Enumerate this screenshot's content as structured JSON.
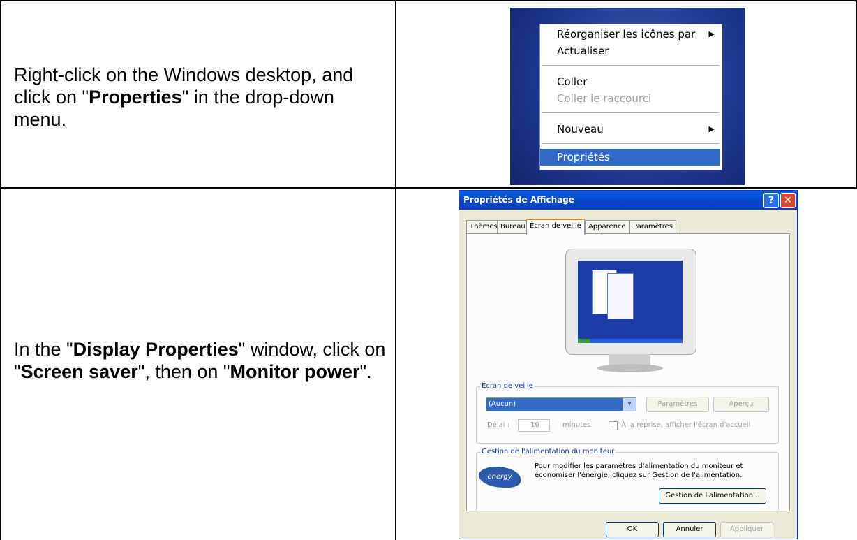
{
  "steps": [
    {
      "instruction_parts": [
        "Right-click on the Windows desktop, and click on \"",
        "Properties",
        "\" in the drop-down menu."
      ]
    },
    {
      "instruction_parts": [
        "In the \"",
        "Display Properties",
        "\" window, click on \"",
        "Screen saver",
        "\", then on \"",
        "Monitor power",
        "\"."
      ]
    }
  ],
  "context_menu": {
    "items": [
      {
        "label": "Réorganiser les icônes par",
        "submenu": true,
        "disabled": false,
        "selected": false
      },
      {
        "label": "Actualiser",
        "submenu": false,
        "disabled": false,
        "selected": false
      },
      {
        "label": "Coller",
        "submenu": false,
        "disabled": false,
        "selected": false
      },
      {
        "label": "Coller le raccourci",
        "submenu": false,
        "disabled": true,
        "selected": false
      },
      {
        "label": "Nouveau",
        "submenu": true,
        "disabled": false,
        "selected": false
      },
      {
        "label": "Propriétés",
        "submenu": false,
        "disabled": false,
        "selected": true
      }
    ],
    "arrow_glyph": "▶"
  },
  "dialog": {
    "title": "Propriétés de Affichage",
    "help_glyph": "?",
    "close_glyph": "✕",
    "tabs": [
      "Thèmes",
      "Bureau",
      "Écran de veille",
      "Apparence",
      "Paramètres"
    ],
    "active_tab": "Écran de veille",
    "screensaver_group": {
      "label": "Écran de veille",
      "selected_value": "(Aucun)",
      "dropdown_glyph": "▾",
      "settings_button": "Paramètres",
      "preview_button": "Aperçu",
      "delay_label": "Délai :",
      "delay_value": "10",
      "minutes_label": "minutes",
      "resume_checkbox_label": "À la reprise, afficher l'écran d'accueil"
    },
    "power_group": {
      "label": "Gestion de l'alimentation du moniteur",
      "description": "Pour modifier les paramètres d'alimentation du moniteur et économiser l'énergie, cliquez sur Gestion de l'alimentation.",
      "power_button": "Gestion de l'alimentation...",
      "logo_text": "energy"
    },
    "ok_button": "OK",
    "cancel_button": "Annuler",
    "apply_button": "Appliquer"
  }
}
